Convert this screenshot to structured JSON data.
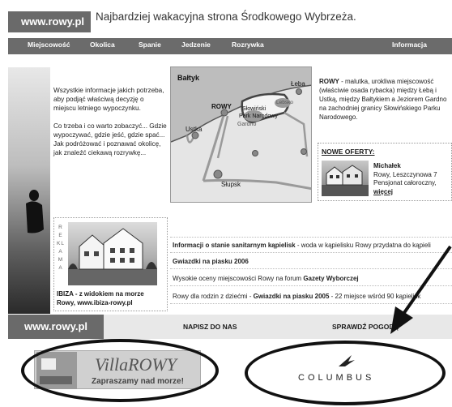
{
  "header": {
    "logo": "www.rowy.pl",
    "tagline": "Najbardziej wakacyjna strona Środkowego Wybrzeża."
  },
  "nav": [
    "Miejscowość",
    "Okolica",
    "Spanie",
    "Jedzenie",
    "Rozrywka",
    "Informacja"
  ],
  "intro": {
    "p1": "Wszystkie informacje jakich potrzeba, aby podjąć właściwą decyzję o miejscu letniego wypoczynku.",
    "p2": "Co trzeba i co warto zobaczyć... Gdzie wypoczywać, gdzie jeść, gdzie spać... Jak podróżować i poznawać okolicę, jak znaleźć ciekawą rozrywkę..."
  },
  "map": {
    "labels": [
      "Bałtyk",
      "Łeba",
      "ROWY",
      "Słowiński",
      "Park Narodowy",
      "Gardno",
      "Lebsko",
      "Ustka",
      "Słupsk"
    ]
  },
  "description": {
    "bold": "ROWY",
    "text": " - malutka, urokliwa miejscowość (właściwie osada rybacka) między Łebą i Ustką, między Bałtykiem a Jeziorem Gardno na zachodniej granicy Słowińskiego Parku Narodowego."
  },
  "offers": {
    "title": "NOWE OFERTY:",
    "name": "Michałek",
    "line1": "Rowy, Leszczynowa 7",
    "line2": "Pensjonat całoroczny,",
    "more": "więcej"
  },
  "ad": {
    "vertical": "REKLAMA",
    "line1": "IBIZA - z widokiem na morze",
    "line2": "Rowy, www.ibiza-rowy.pl"
  },
  "news": [
    {
      "bold": "Informacji o stanie sanitarnym kąpielisk",
      "text": " - woda w kąpielisku Rowy przydatna do kąpieli"
    },
    {
      "bold": "Gwiazdki na piasku 2006",
      "text": ""
    },
    {
      "bold": "",
      "text": "Wysokie oceny miejscowości Rowy na forum ",
      "bold2": "Gazety Wyborczej"
    },
    {
      "bold": "",
      "text": "Rowy dla rodzin z dziećmi - ",
      "bold2": "Gwiazdki na piasku 2005",
      "text2": " - 22 miejsce wśród 90 kąpielisk"
    }
  ],
  "footer": {
    "logo": "www.rowy.pl",
    "contact": "NAPISZ DO NAS",
    "weather": "SPRAWDŹ POGODĘ"
  },
  "banners": {
    "villa_title": "VillaROWY",
    "villa_sub": "Zapraszamy nad morze!",
    "columbus": "COLUMBUS"
  }
}
